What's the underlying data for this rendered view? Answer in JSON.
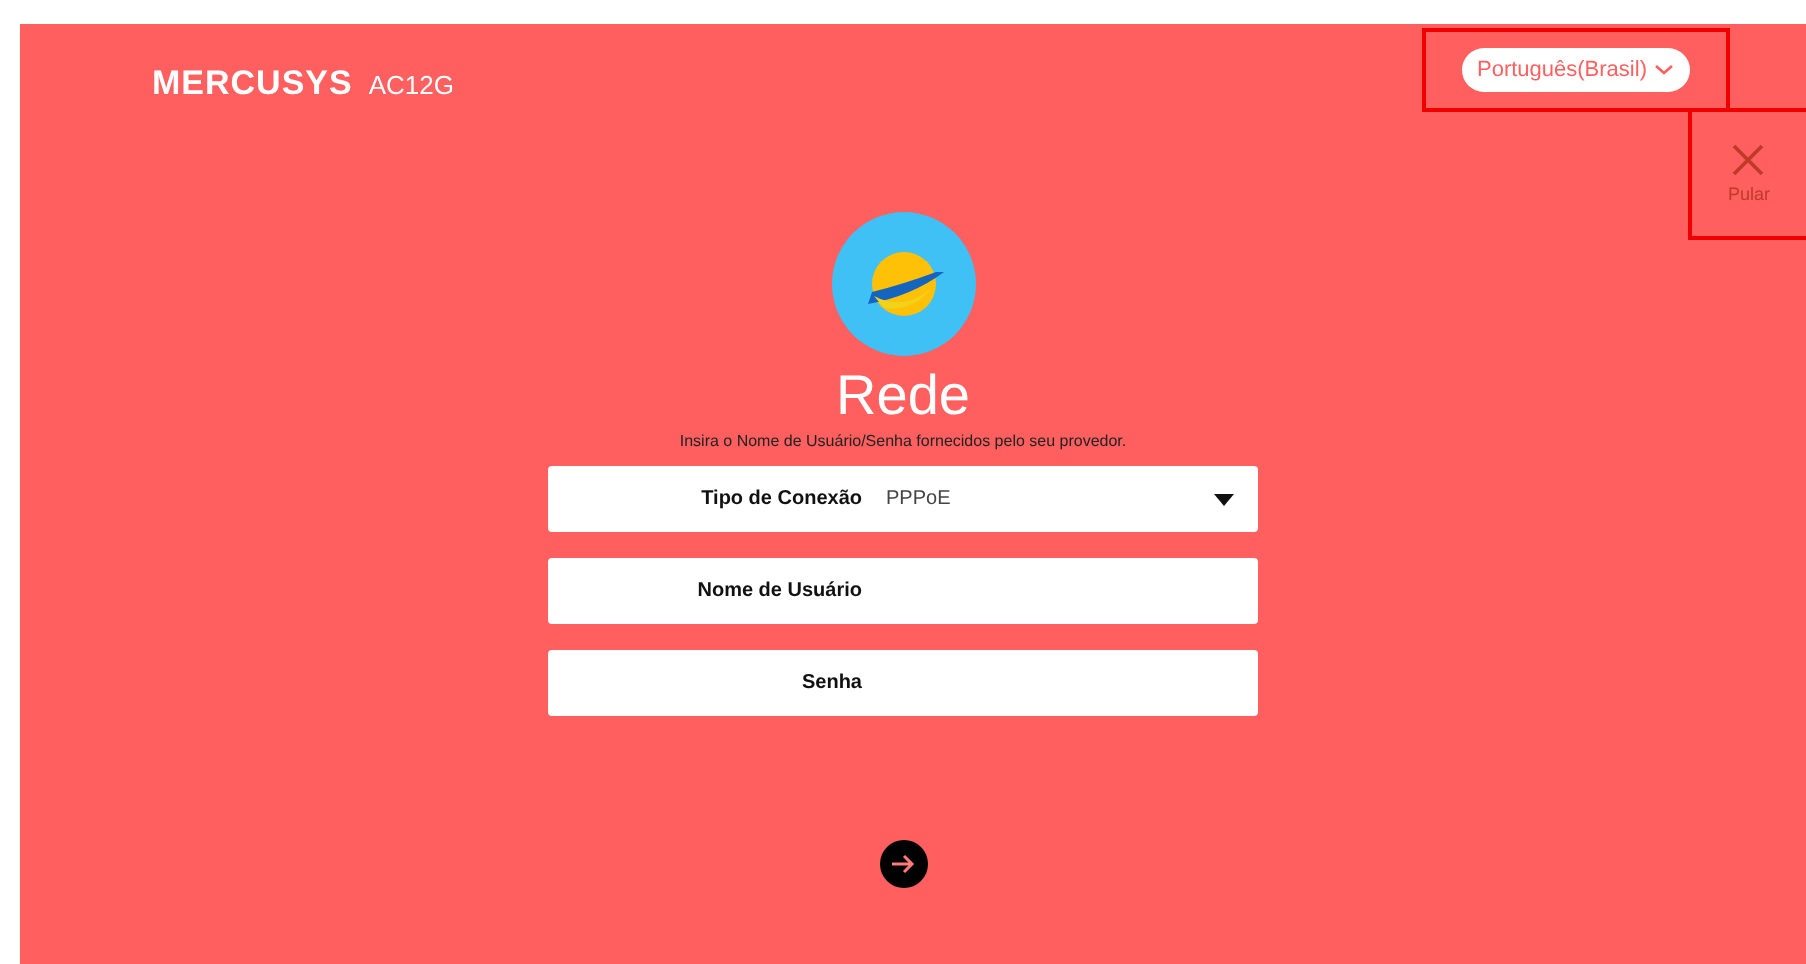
{
  "header": {
    "logo": "MERCUSYS",
    "model": "AC12G",
    "language": "Português(Brasil)",
    "skip": "Pular"
  },
  "title": "Rede",
  "subtitle": "Insira o Nome de Usuário/Senha fornecidos pelo seu provedor.",
  "fields": [
    {
      "kind": "select",
      "label": "Tipo de Conexão",
      "value": "PPPoE"
    },
    {
      "kind": "text",
      "label": "Nome de Usuário"
    },
    {
      "kind": "password",
      "label": "Senha"
    }
  ]
}
